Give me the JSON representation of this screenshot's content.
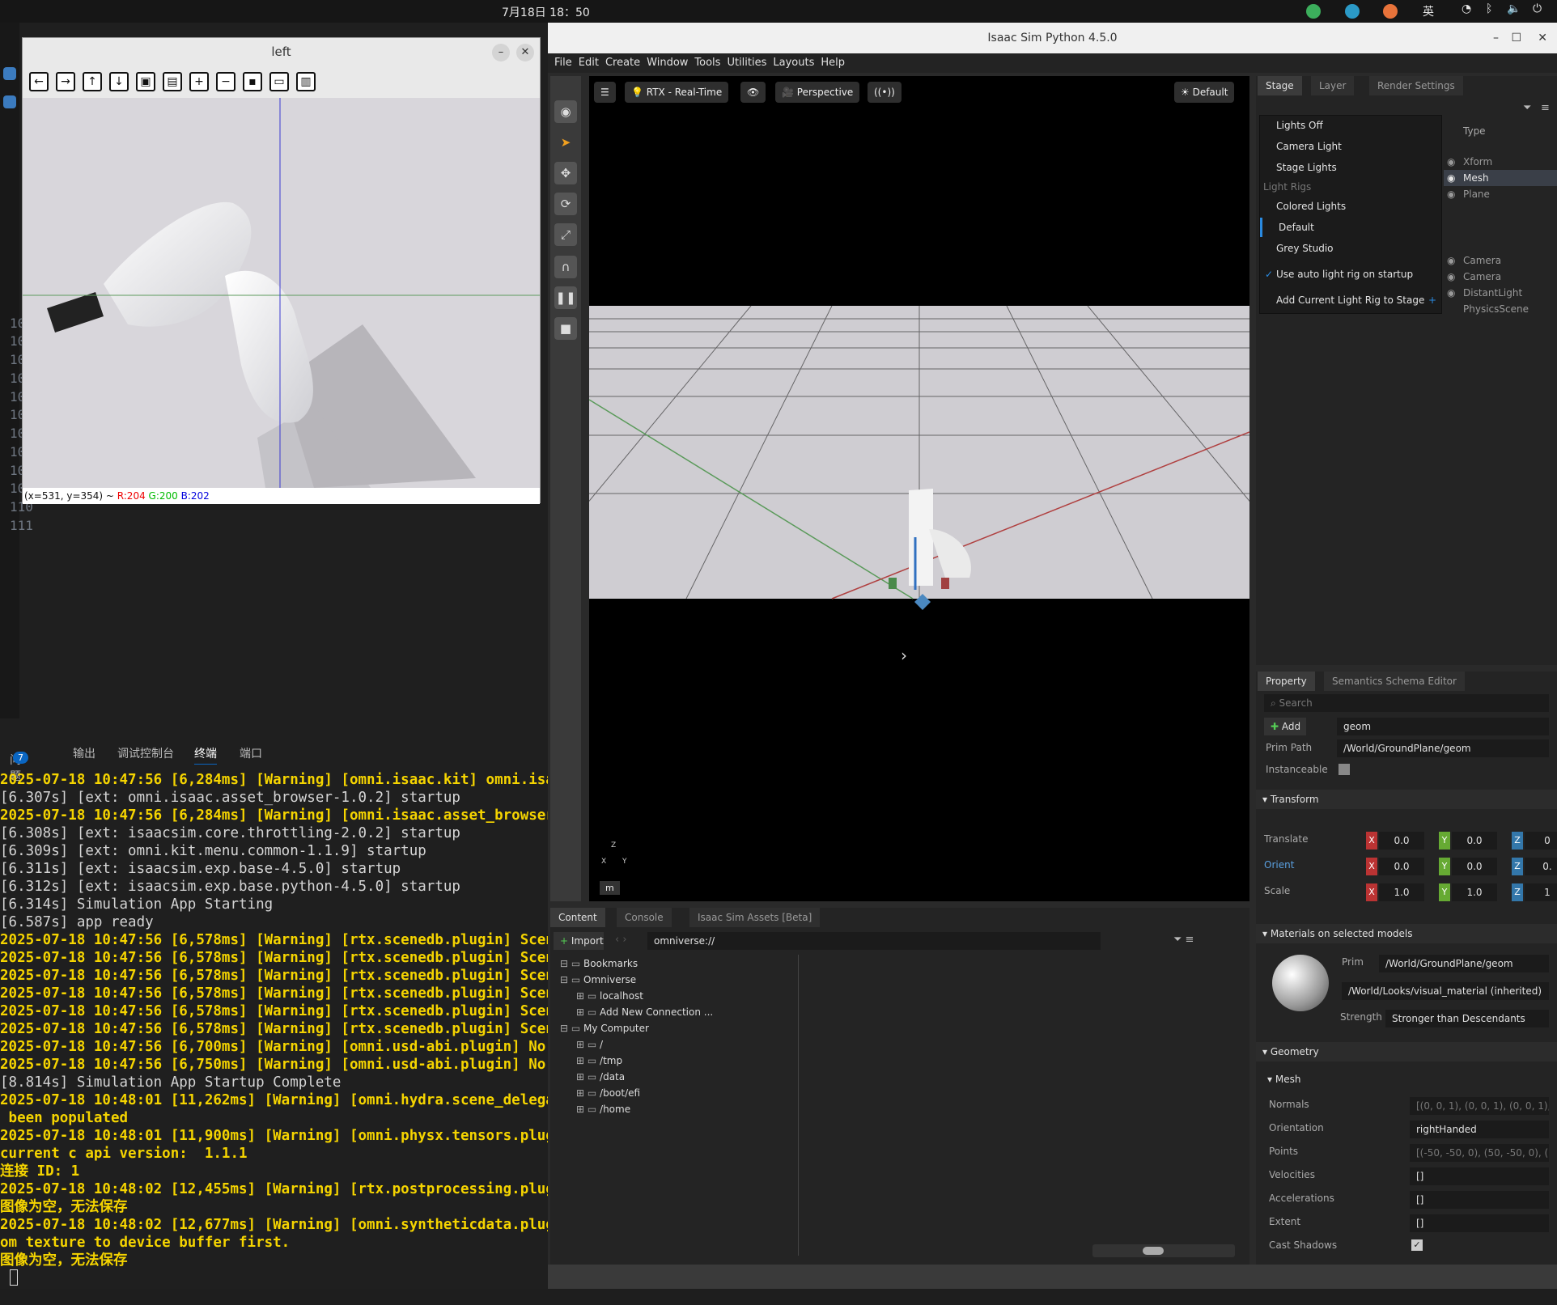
{
  "topbar": {
    "clock": "7月18日  18：50",
    "ime": "英"
  },
  "vscode": {
    "gutter_labels": [
      "10",
      "10",
      "10",
      "10",
      "10",
      "10",
      "10",
      "10",
      "10",
      "10",
      "110",
      "111"
    ],
    "panel_tabs": {
      "problems": "问题",
      "problems_count": "7",
      "output": "输出",
      "debug_console": "调试控制台",
      "terminal": "终端",
      "ports": "端口"
    },
    "terminal_lines": [
      {
        "style": "w",
        "text": "2025-07-18 10:47:56 [6,284ms] [Warning] [omni.isaac.kit] omni.isaac"
      },
      {
        "style": "n",
        "text": "[6.307s] [ext: omni.isaac.asset_browser-1.0.2] startup"
      },
      {
        "style": "w",
        "text": "2025-07-18 10:47:56 [6,284ms] [Warning] [omni.isaac.asset_browser] "
      },
      {
        "style": "n",
        "text": "[6.308s] [ext: isaacsim.core.throttling-2.0.2] startup"
      },
      {
        "style": "n",
        "text": "[6.309s] [ext: omni.kit.menu.common-1.1.9] startup"
      },
      {
        "style": "n",
        "text": "[6.311s] [ext: isaacsim.exp.base-4.5.0] startup"
      },
      {
        "style": "n",
        "text": "[6.312s] [ext: isaacsim.exp.base.python-4.5.0] startup"
      },
      {
        "style": "n",
        "text": "[6.314s] Simulation App Starting"
      },
      {
        "style": "n",
        "text": "[6.587s] app ready"
      },
      {
        "style": "w",
        "text": "2025-07-18 10:47:56 [6,578ms] [Warning] [rtx.scenedb.plugin] SceneD"
      },
      {
        "style": "w",
        "text": "2025-07-18 10:47:56 [6,578ms] [Warning] [rtx.scenedb.plugin] SceneD"
      },
      {
        "style": "w",
        "text": "2025-07-18 10:47:56 [6,578ms] [Warning] [rtx.scenedb.plugin] SceneD"
      },
      {
        "style": "w",
        "text": "2025-07-18 10:47:56 [6,578ms] [Warning] [rtx.scenedb.plugin] SceneD"
      },
      {
        "style": "w",
        "text": "2025-07-18 10:47:56 [6,578ms] [Warning] [rtx.scenedb.plugin] SceneD"
      },
      {
        "style": "w",
        "text": "2025-07-18 10:47:56 [6,578ms] [Warning] [rtx.scenedb.plugin] SceneD"
      },
      {
        "style": "w",
        "text": "2025-07-18 10:47:56 [6,700ms] [Warning] [omni.usd-abi.plugin] No se"
      },
      {
        "style": "w",
        "text": "2025-07-18 10:47:56 [6,750ms] [Warning] [omni.usd-abi.plugin] No se"
      },
      {
        "style": "n",
        "text": "[8.814s] Simulation App Startup Complete"
      },
      {
        "style": "w",
        "text": "2025-07-18 10:48:01 [11,262ms] [Warning] [omni.hydra.scene_delegate"
      },
      {
        "style": "w",
        "text": " been populated"
      },
      {
        "style": "w",
        "text": "2025-07-18 10:48:01 [11,900ms] [Warning] [omni.physx.tensors.plugin"
      },
      {
        "style": "w",
        "text": "current c api version:  1.1.1"
      },
      {
        "style": "w",
        "text": "连接 ID: 1"
      },
      {
        "style": "w",
        "text": "2025-07-18 10:48:02 [12,455ms] [Warning] [rtx.postprocessing.plugin"
      },
      {
        "style": "w",
        "text": "图像为空，无法保存"
      },
      {
        "style": "w",
        "text": "2025-07-18 10:48:02 [12,677ms] [Warning] [omni.syntheticdata.plugin"
      },
      {
        "style": "w",
        "text": "om texture to device buffer first."
      },
      {
        "style": "w",
        "text": "图像为空，无法保存"
      }
    ]
  },
  "left_window": {
    "title": "left",
    "status_pos": "(x=531, y=354) ~ ",
    "status_r": "R:204",
    "status_g": "G:200",
    "status_b": "B:202"
  },
  "isaac": {
    "title": "Isaac Sim Python 4.5.0",
    "menu": [
      "File",
      "Edit",
      "Create",
      "Window",
      "Tools",
      "Utilities",
      "Layouts",
      "Help"
    ],
    "viewport": {
      "renderer": "RTX - Real-Time",
      "camera": "Perspective",
      "lighting": "Default",
      "units": "m",
      "axis_z": "Z",
      "axis_x": "X",
      "axis_y": "Y"
    },
    "stage_tabs": [
      "Stage",
      "Layer",
      "Render Settings"
    ],
    "stage_type_header": "Type",
    "stage_types": [
      "Xform",
      "Mesh",
      "Plane",
      "Camera",
      "Camera",
      "DistantLight",
      "PhysicsScene"
    ],
    "light_menu": {
      "lights_off": "Lights Off",
      "camera_light": "Camera Light",
      "stage_lights": "Stage Lights",
      "rigs_header": "Light Rigs",
      "colored": "Colored Lights",
      "default": "Default",
      "grey": "Grey Studio",
      "auto": "Use auto light rig on startup",
      "add_current": "Add Current Light Rig to Stage"
    },
    "property": {
      "tabs": [
        "Property",
        "Semantics Schema Editor"
      ],
      "search_placeholder": "Search",
      "add": "Add",
      "name": "geom",
      "prim_path_label": "Prim Path",
      "prim_path": "/World/GroundPlane/geom",
      "instanceable": "Instanceable",
      "transform": "Transform",
      "translate": "Translate",
      "orient": "Orient",
      "scale": "Scale",
      "t_x": "0.0",
      "t_y": "0.0",
      "t_z": "0",
      "o_x": "0.0",
      "o_y": "0.0",
      "o_z": "0.",
      "s_x": "1.0",
      "s_y": "1.0",
      "s_z": "1",
      "materials": "Materials on selected models",
      "mat_prim_label": "Prim",
      "mat_prim": "/World/GroundPlane/geom",
      "mat_material": "/World/Looks/visual_material (inherited)",
      "strength_label": "Strength",
      "strength": "Stronger than Descendants",
      "geometry": "Geometry",
      "mesh": "Mesh",
      "normals_label": "Normals",
      "normals": "[(0, 0, 1), (0, 0, 1), (0, 0, 1), (0,",
      "orientation_label": "Orientation",
      "orientation": "rightHanded",
      "points_label": "Points",
      "points": "[(-50, -50, 0), (50, -50, 0), (50,",
      "velocities_label": "Velocities",
      "velocities": "[]",
      "accelerations_label": "Accelerations",
      "accelerations": "[]",
      "extent_label": "Extent",
      "extent": "[]",
      "cast_shadows_label": "Cast Shadows"
    },
    "content": {
      "tabs": [
        "Content",
        "Console",
        "Isaac Sim Assets [Beta]"
      ],
      "import": "Import",
      "path": "omniverse://",
      "tree": [
        {
          "indent": 0,
          "label": "Bookmarks"
        },
        {
          "indent": 0,
          "label": "Omniverse"
        },
        {
          "indent": 1,
          "label": "localhost"
        },
        {
          "indent": 1,
          "label": "Add New Connection ..."
        },
        {
          "indent": 0,
          "label": "My Computer"
        },
        {
          "indent": 1,
          "label": "/"
        },
        {
          "indent": 1,
          "label": "/tmp"
        },
        {
          "indent": 1,
          "label": "/data"
        },
        {
          "indent": 1,
          "label": "/boot/efi"
        },
        {
          "indent": 1,
          "label": "/home"
        }
      ]
    }
  }
}
